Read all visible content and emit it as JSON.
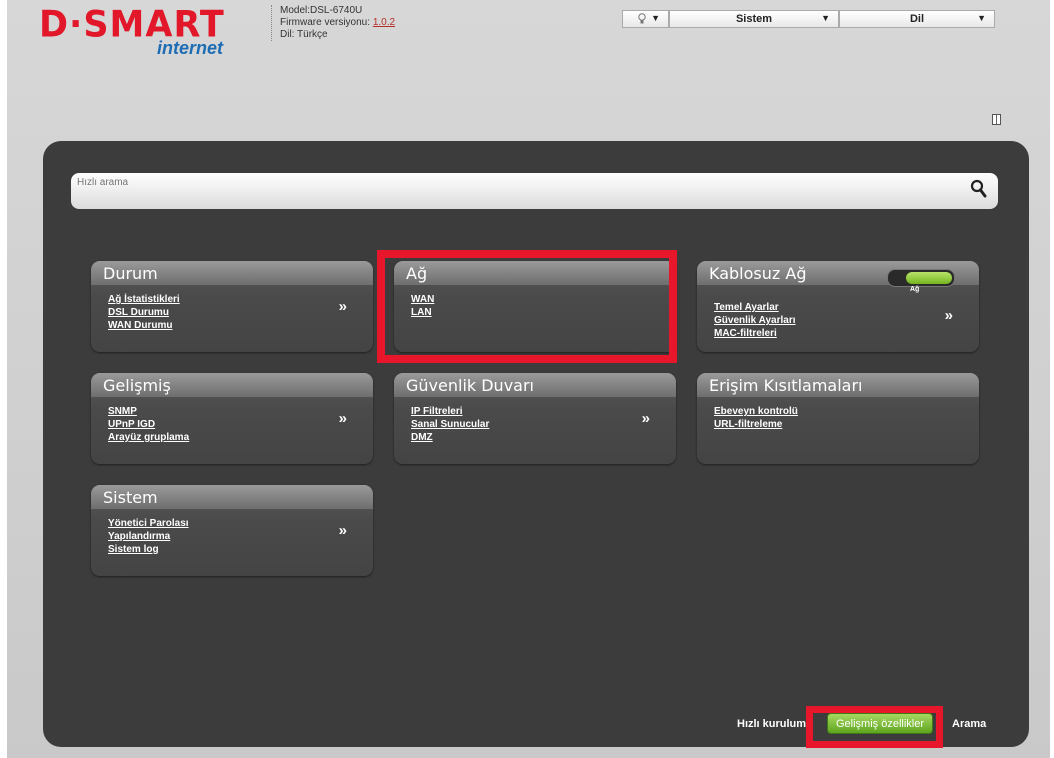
{
  "brand": {
    "logo_main": "D·SMART",
    "logo_sub": "internet"
  },
  "info": {
    "model_label": "Model:DSL-6740U",
    "firmware_label": "Firmware versiyonu: ",
    "firmware_value": "1.0.2",
    "lang_label": "Dil: Türkçe"
  },
  "topbar": {
    "sistem": "Sistem",
    "dil": "Dil"
  },
  "search": {
    "placeholder": "Hızlı arama"
  },
  "cards": {
    "durum": {
      "title": "Durum",
      "links": [
        "Ağ İstatistikleri",
        "DSL Durumu",
        "WAN Durumu"
      ],
      "more": "»"
    },
    "ag": {
      "title": "Ağ",
      "links": [
        "WAN",
        "LAN"
      ]
    },
    "kablosuz": {
      "title": "Kablosuz Ağ",
      "toggle_label": "Ağ",
      "links": [
        "Temel Ayarlar",
        "Güvenlik Ayarları",
        "MAC-filtreleri"
      ],
      "more": "»"
    },
    "gelismis": {
      "title": "Gelişmiş",
      "links": [
        "SNMP",
        "UPnP IGD",
        "Arayüz gruplama"
      ],
      "more": "»"
    },
    "guvenlik": {
      "title": "Güvenlik Duvarı",
      "links": [
        "IP Filtreleri",
        "Sanal Sunucular",
        "DMZ"
      ],
      "more": "»"
    },
    "erisim": {
      "title": "Erişim Kısıtlamaları",
      "links": [
        "Ebeveyn kontrolü",
        "URL-filtreleme"
      ]
    },
    "sistem": {
      "title": "Sistem",
      "links": [
        "Yönetici Parolası",
        "Yapılandırma",
        "Sistem log"
      ],
      "more": "»"
    }
  },
  "footer": {
    "quick_setup": "Hızlı kurulum",
    "advanced": "Gelişmiş özellikler",
    "search": "Arama"
  },
  "colors": {
    "brand_red": "#e2172a",
    "highlight": "#e8162a",
    "button_green": "#74b420"
  }
}
